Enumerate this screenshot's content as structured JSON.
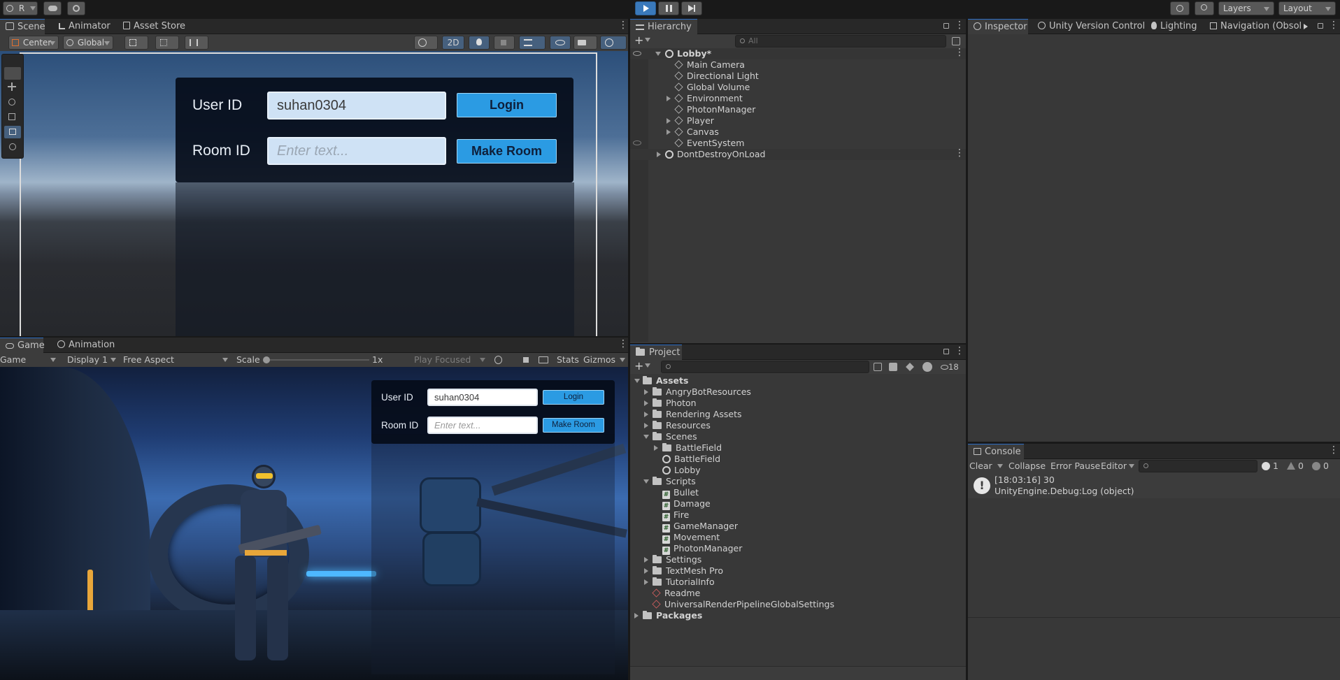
{
  "toolbar": {
    "account": "R",
    "layers": "Layers",
    "layout": "Layout"
  },
  "scene_tabs": [
    "Scene",
    "Animator",
    "Asset Store"
  ],
  "scene_toolbar": {
    "pivot": "Center",
    "space": "Global",
    "mode_2d": "2D"
  },
  "scene_ui": {
    "user_label": "User ID",
    "user_value": "suhan0304",
    "login": "Login",
    "room_label": "Room ID",
    "room_placeholder": "Enter text...",
    "make_room": "Make Room"
  },
  "game_tabs": [
    "Game",
    "Animation"
  ],
  "game_toolbar": {
    "view": "Game",
    "display": "Display 1",
    "aspect": "Free Aspect",
    "scale_label": "Scale",
    "scale_value": "1x",
    "play_focused": "Play Focused",
    "stats": "Stats",
    "gizmos": "Gizmos"
  },
  "game_ui": {
    "user_label": "User ID",
    "user_value": "suhan0304",
    "login": "Login",
    "room_label": "Room ID",
    "room_placeholder": "Enter text...",
    "make_room": "Make Room"
  },
  "hierarchy": {
    "title": "Hierarchy",
    "search_placeholder": "All",
    "items": [
      {
        "label": "Lobby*",
        "depth": 0,
        "kind": "scene",
        "expanded": true
      },
      {
        "label": "Main Camera",
        "depth": 1,
        "kind": "object"
      },
      {
        "label": "Directional Light",
        "depth": 1,
        "kind": "object"
      },
      {
        "label": "Global Volume",
        "depth": 1,
        "kind": "object"
      },
      {
        "label": "Environment",
        "depth": 1,
        "kind": "object",
        "collapsed": true
      },
      {
        "label": "PhotonManager",
        "depth": 1,
        "kind": "object"
      },
      {
        "label": "Player",
        "depth": 1,
        "kind": "object",
        "collapsed": true
      },
      {
        "label": "Canvas",
        "depth": 1,
        "kind": "object",
        "collapsed": true
      },
      {
        "label": "EventSystem",
        "depth": 1,
        "kind": "object"
      },
      {
        "label": "DontDestroyOnLoad",
        "depth": 0,
        "kind": "scene",
        "collapsed": true
      }
    ]
  },
  "inspector_tabs": [
    "Inspector",
    "Unity Version Control",
    "Lighting",
    "Navigation (Obsolete"
  ],
  "project": {
    "title": "Project",
    "hidden_count": "18",
    "items": [
      {
        "label": "Assets",
        "depth": 0,
        "kind": "folder",
        "expanded": true,
        "bold": true
      },
      {
        "label": "AngryBotResources",
        "depth": 1,
        "kind": "folder",
        "collapsed": true
      },
      {
        "label": "Photon",
        "depth": 1,
        "kind": "folder",
        "collapsed": true
      },
      {
        "label": "Rendering Assets",
        "depth": 1,
        "kind": "folder",
        "collapsed": true
      },
      {
        "label": "Resources",
        "depth": 1,
        "kind": "folder",
        "collapsed": true
      },
      {
        "label": "Scenes",
        "depth": 1,
        "kind": "folder",
        "expanded": true
      },
      {
        "label": "BattleField",
        "depth": 2,
        "kind": "folder",
        "collapsed": true
      },
      {
        "label": "BattleField",
        "depth": 2,
        "kind": "scene"
      },
      {
        "label": "Lobby",
        "depth": 2,
        "kind": "scene"
      },
      {
        "label": "Scripts",
        "depth": 1,
        "kind": "folder",
        "expanded": true
      },
      {
        "label": "Bullet",
        "depth": 2,
        "kind": "script"
      },
      {
        "label": "Damage",
        "depth": 2,
        "kind": "script"
      },
      {
        "label": "Fire",
        "depth": 2,
        "kind": "script"
      },
      {
        "label": "GameManager",
        "depth": 2,
        "kind": "script"
      },
      {
        "label": "Movement",
        "depth": 2,
        "kind": "script"
      },
      {
        "label": "PhotonManager",
        "depth": 2,
        "kind": "script"
      },
      {
        "label": "Settings",
        "depth": 1,
        "kind": "folder",
        "collapsed": true
      },
      {
        "label": "TextMesh Pro",
        "depth": 1,
        "kind": "folder",
        "collapsed": true
      },
      {
        "label": "TutorialInfo",
        "depth": 1,
        "kind": "folder",
        "collapsed": true
      },
      {
        "label": "Readme",
        "depth": 1,
        "kind": "asset"
      },
      {
        "label": "UniversalRenderPipelineGlobalSettings",
        "depth": 1,
        "kind": "asset"
      },
      {
        "label": "Packages",
        "depth": 0,
        "kind": "folder",
        "collapsed": true,
        "bold": true
      }
    ]
  },
  "console": {
    "title": "Console",
    "clear": "Clear",
    "collapse": "Collapse",
    "error_pause": "Error Pause",
    "editor": "Editor",
    "count_log": "1",
    "count_warn": "0",
    "count_error": "0",
    "entries": [
      {
        "line1": "[18:03:16] 30",
        "line2": "UnityEngine.Debug:Log (object)"
      }
    ]
  },
  "colors": {
    "accent": "#2b6cc4",
    "ui_button": "#2b9be3",
    "panel": "#383838"
  }
}
